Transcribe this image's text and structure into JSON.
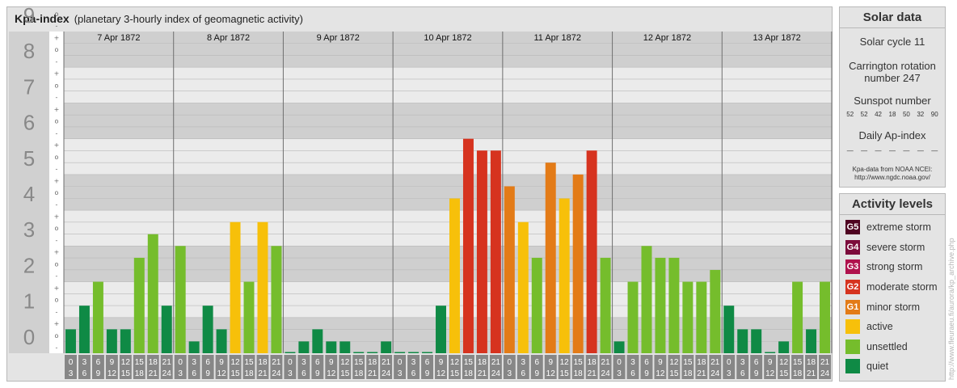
{
  "header": {
    "title": "Kpa-index",
    "subtitle": "(planetary 3-hourly index of geomagnetic activity)"
  },
  "chart_data": {
    "type": "bar",
    "days": [
      "7 Apr 1872",
      "8 Apr 1872",
      "9 Apr 1872",
      "10 Apr 1872",
      "11 Apr 1872",
      "12 Apr 1872",
      "13 Apr 1872"
    ],
    "interval_start_labels": [
      "0",
      "3",
      "6",
      "9",
      "12",
      "15",
      "18",
      "21"
    ],
    "interval_end_labels": [
      "3",
      "6",
      "9",
      "12",
      "15",
      "18",
      "21",
      "24"
    ],
    "y_tick_labels": [
      "0",
      "1",
      "2",
      "3",
      "4",
      "5",
      "6",
      "7",
      "8",
      "9"
    ],
    "y_minor_labels": [
      "-",
      "o",
      "+"
    ],
    "ylim": [
      0,
      9
    ],
    "values": [
      0.67,
      1.33,
      2,
      0.67,
      0.67,
      2.67,
      3.33,
      1.33,
      3,
      0.33,
      1.33,
      0.67,
      3.67,
      2,
      3.67,
      3,
      0,
      0.33,
      0.67,
      0.33,
      0.33,
      0,
      0,
      0.33,
      0,
      0,
      0,
      1.33,
      4.33,
      6,
      5.67,
      5.67,
      4.67,
      3.67,
      2.67,
      5.33,
      4.33,
      5,
      5.67,
      2.67,
      0.33,
      2,
      3,
      2.67,
      2.67,
      2,
      2,
      2.33,
      1.33,
      0.67,
      0.67,
      0,
      0.33,
      2,
      0.67,
      2
    ],
    "colors": {
      "quiet": "#0f8a45",
      "unsettled": "#75bd2c",
      "active": "#f7c00a",
      "G1": "#e37b17",
      "G2": "#d6331f",
      "G3": "#b0124d",
      "G4": "#7c0b3b",
      "G5": "#4f0321"
    }
  },
  "solar": {
    "heading": "Solar data",
    "cycle": "Solar cycle 11",
    "carrington_line1": "Carrington rotation",
    "carrington_line2": "number 247",
    "sunspot_label": "Sunspot number",
    "sunspots": [
      "52",
      "52",
      "42",
      "18",
      "50",
      "32",
      "90"
    ],
    "ap_label": "Daily Ap-index",
    "ap_values": [
      "—",
      "—",
      "—",
      "—",
      "—",
      "—",
      "—"
    ],
    "source_line1": "Kpa-data from NOAA NCEI:",
    "source_line2": "http://www.ngdc.noaa.gov/"
  },
  "levels": {
    "heading": "Activity levels",
    "items": [
      {
        "badge": "G5",
        "label": "extreme storm",
        "color": "#4f0321"
      },
      {
        "badge": "G4",
        "label": "severe storm",
        "color": "#7c0b3b"
      },
      {
        "badge": "G3",
        "label": "strong storm",
        "color": "#b0124d"
      },
      {
        "badge": "G2",
        "label": "moderate storm",
        "color": "#d6331f"
      },
      {
        "badge": "G1",
        "label": "minor storm",
        "color": "#e37b17"
      },
      {
        "badge": "",
        "label": "active",
        "color": "#f7c00a"
      },
      {
        "badge": "",
        "label": "unsettled",
        "color": "#75bd2c"
      },
      {
        "badge": "",
        "label": "quiet",
        "color": "#0f8a45"
      }
    ]
  },
  "credit": "http://www.fleuraeu.fi/aurora/kp_archive.php"
}
